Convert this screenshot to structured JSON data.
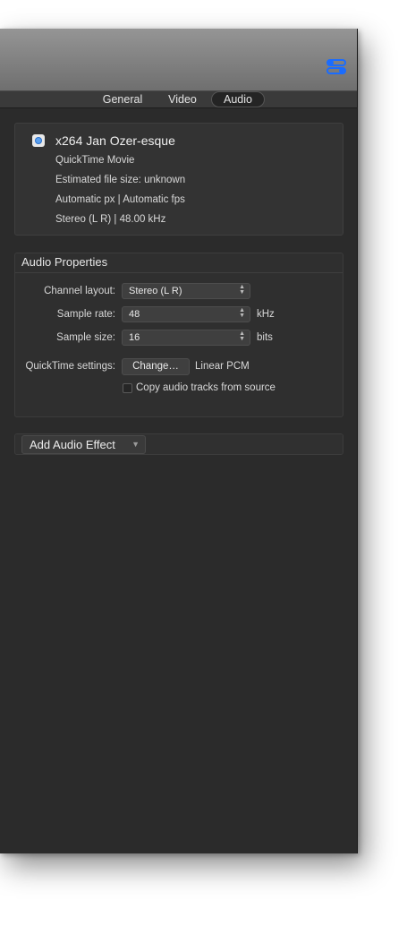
{
  "tabs": [
    {
      "label": "General"
    },
    {
      "label": "Video"
    },
    {
      "label": "Audio",
      "selected": true
    }
  ],
  "toolbar": {
    "inspector_icon": "inspector-toggle-icon",
    "accent": "#1a6cff"
  },
  "summary": {
    "title": "x264 Jan Ozer-esque",
    "format": "QuickTime Movie",
    "file_size": "Estimated file size: unknown",
    "video": "Automatic px | Automatic fps",
    "audio": "Stereo (L R) | 48.00 kHz"
  },
  "audio_properties": {
    "header": "Audio Properties",
    "channel_layout": {
      "label": "Channel layout:",
      "value": "Stereo (L R)"
    },
    "sample_rate": {
      "label": "Sample rate:",
      "value": "48",
      "unit": "kHz"
    },
    "sample_size": {
      "label": "Sample size:",
      "value": "16",
      "unit": "bits"
    },
    "quicktime_settings": {
      "label": "QuickTime settings:",
      "button": "Change…",
      "value": "Linear PCM"
    },
    "copy_tracks": {
      "label": "Copy audio tracks from source",
      "checked": false
    }
  },
  "effects": {
    "add_label": "Add Audio Effect"
  }
}
